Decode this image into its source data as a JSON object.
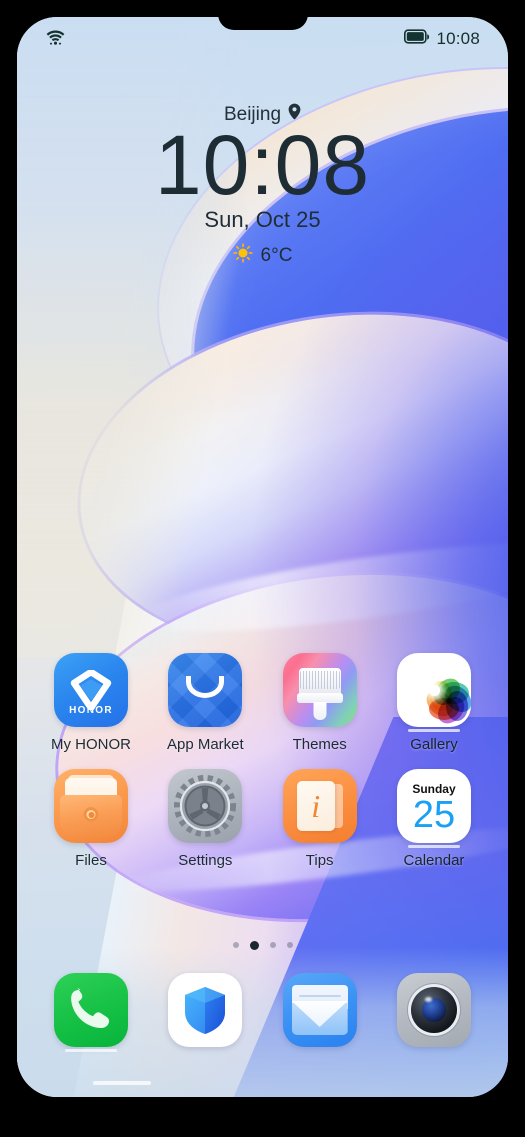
{
  "device": {
    "screen_label": "phone-home-screen"
  },
  "status_bar": {
    "wifi_icon": "wifi-icon",
    "battery_icon": "battery-full-icon",
    "time": "10:08"
  },
  "clock_widget": {
    "city": "Beijing",
    "location_icon": "location-pin-icon",
    "time": "10:08",
    "date": "Sun, Oct 25",
    "weather_icon": "sun-icon",
    "temperature": "6°C"
  },
  "apps": {
    "row1": [
      {
        "label": "My HONOR",
        "icon": "my-honor-icon",
        "brand_text": "HONOR"
      },
      {
        "label": "App Market",
        "icon": "app-market-icon"
      },
      {
        "label": "Themes",
        "icon": "themes-icon"
      },
      {
        "label": "Gallery",
        "icon": "gallery-icon"
      }
    ],
    "row2": [
      {
        "label": "Files",
        "icon": "files-icon"
      },
      {
        "label": "Settings",
        "icon": "settings-icon"
      },
      {
        "label": "Tips",
        "icon": "tips-icon"
      },
      {
        "label": "Calendar",
        "icon": "calendar-icon",
        "cal_day": "Sunday",
        "cal_date": "25"
      }
    ]
  },
  "dock": [
    {
      "label": "Phone",
      "icon": "phone-icon"
    },
    {
      "label": "Optimizer",
      "icon": "shield-icon"
    },
    {
      "label": "Email",
      "icon": "email-icon"
    },
    {
      "label": "Camera",
      "icon": "camera-icon"
    }
  ],
  "page_indicator": {
    "total": 4,
    "active_index": 1
  },
  "colors": {
    "accent_blue": "#2b81ef",
    "honor_blue": "#2472e8",
    "files_orange": "#f2853a",
    "tips_orange": "#f47e2e",
    "phone_green": "#07b43a",
    "calendar_blue": "#1aa0f5",
    "status_text": "#13302e"
  }
}
